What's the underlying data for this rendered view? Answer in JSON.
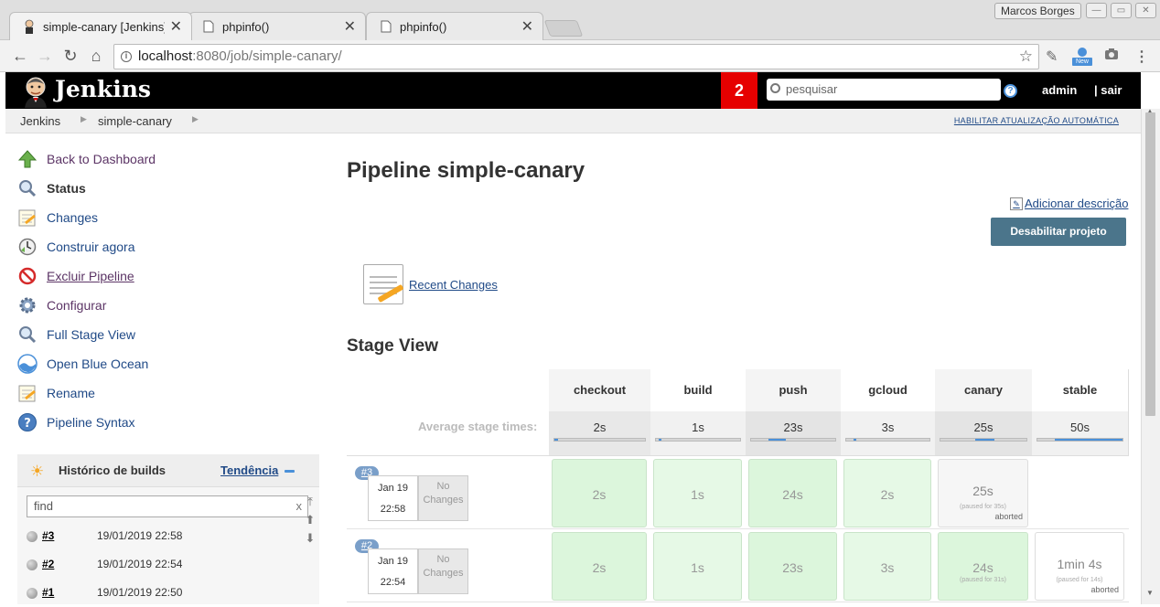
{
  "browser": {
    "tabs": [
      {
        "title": "simple-canary [Jenkins]",
        "icon": "jenkins-butler-icon"
      },
      {
        "title": "phpinfo()",
        "icon": "page-icon"
      },
      {
        "title": "phpinfo()",
        "icon": "page-icon"
      }
    ],
    "profile_name": "Marcos Borges",
    "url_host": "localhost",
    "url_path": ":8080/job/simple-canary/",
    "new_badge": "New"
  },
  "header": {
    "brand": "Jenkins",
    "notifications": "2",
    "search_placeholder": "pesquisar",
    "help": "?",
    "user": "admin",
    "logout": "| sair"
  },
  "breadcrumb": {
    "items": [
      "Jenkins",
      "simple-canary"
    ],
    "auto_refresh": "HABILITAR ATUALIZAÇÃO AUTOMÁTICA"
  },
  "sidebar": {
    "tasks": [
      {
        "label": "Back to Dashboard",
        "icon": "up-arrow-icon"
      },
      {
        "label": "Status",
        "icon": "magnifier-icon"
      },
      {
        "label": "Changes",
        "icon": "notepad-icon"
      },
      {
        "label": "Construir agora",
        "icon": "clock-icon"
      },
      {
        "label": "Excluir Pipeline",
        "icon": "no-entry-icon"
      },
      {
        "label": "Configurar",
        "icon": "gear-icon"
      },
      {
        "label": "Full Stage View",
        "icon": "magnifier-icon"
      },
      {
        "label": "Open Blue Ocean",
        "icon": "blue-ocean-icon"
      },
      {
        "label": "Rename",
        "icon": "notepad-icon"
      },
      {
        "label": "Pipeline Syntax",
        "icon": "help-icon"
      }
    ]
  },
  "history": {
    "title": "Histórico de builds",
    "trend": "Tendência",
    "find_placeholder": "find",
    "clear": "x",
    "builds": [
      {
        "num": "#3",
        "date": "19/01/2019 22:58"
      },
      {
        "num": "#2",
        "date": "19/01/2019 22:54"
      },
      {
        "num": "#1",
        "date": "19/01/2019 22:50"
      }
    ]
  },
  "main": {
    "title": "Pipeline simple-canary",
    "add_description": "Adicionar descrição",
    "disable_button": "Desabilitar projeto",
    "recent_changes": "Recent Changes",
    "stage_view_title": "Stage View"
  },
  "stage_view": {
    "avg_label": "Average stage times:",
    "stages": [
      {
        "name": "checkout",
        "avg": "2s",
        "bar_fill": 0.04
      },
      {
        "name": "build",
        "avg": "1s",
        "bar_fill": 0.02
      },
      {
        "name": "push",
        "avg": "23s",
        "bar_fill": 0.23
      },
      {
        "name": "gcloud",
        "avg": "3s",
        "bar_fill": 0.03
      },
      {
        "name": "canary",
        "avg": "25s",
        "bar_fill": 0.25
      },
      {
        "name": "stable",
        "avg": "50s",
        "bar_fill": 0.5
      }
    ],
    "runs": [
      {
        "badge": "#3",
        "date": "Jan 19",
        "time": "22:58",
        "changes": "No Changes",
        "cells": [
          {
            "value": "2s",
            "style": "g1"
          },
          {
            "value": "1s",
            "style": "g2"
          },
          {
            "value": "24s",
            "style": "g1"
          },
          {
            "value": "2s",
            "style": "g2"
          },
          {
            "value": "25s",
            "style": "gr",
            "paused": "(paused for 35s)",
            "status": "aborted"
          },
          {
            "value": "",
            "style": "none"
          }
        ]
      },
      {
        "badge": "#2",
        "date": "Jan 19",
        "time": "22:54",
        "changes": "No Changes",
        "cells": [
          {
            "value": "2s",
            "style": "g1"
          },
          {
            "value": "1s",
            "style": "g2"
          },
          {
            "value": "23s",
            "style": "g1"
          },
          {
            "value": "3s",
            "style": "g2"
          },
          {
            "value": "24s",
            "style": "g1",
            "paused": "(paused for 31s)"
          },
          {
            "value": "1min 4s",
            "style": "wh",
            "paused": "(paused for 14s)",
            "status": "aborted"
          }
        ]
      }
    ]
  }
}
